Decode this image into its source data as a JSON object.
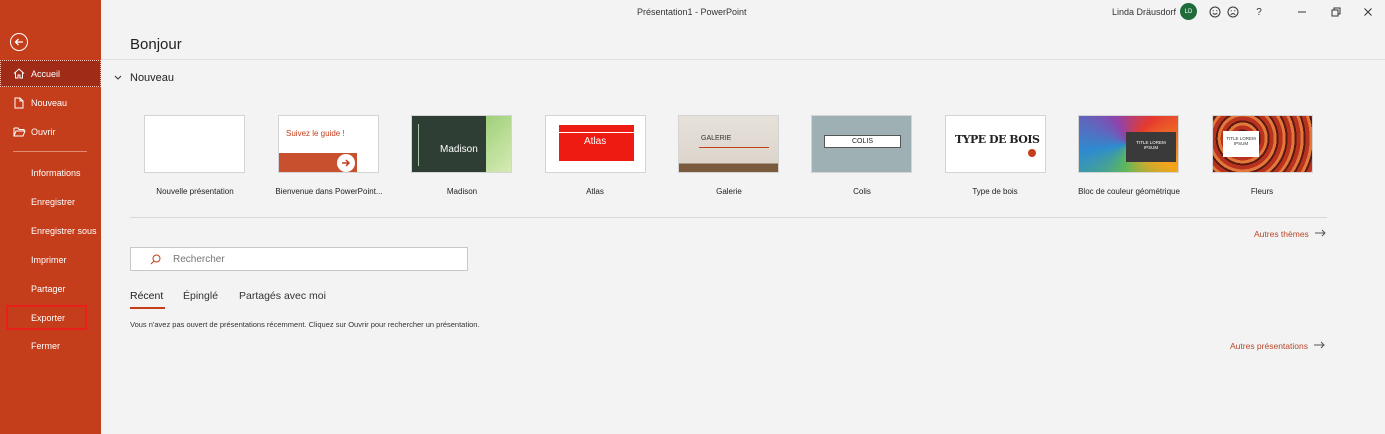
{
  "window": {
    "title": "Présentation1  -  PowerPoint"
  },
  "user": {
    "name": "Linda Dräusdorf",
    "initials": "LD"
  },
  "header": {
    "title": "Bonjour"
  },
  "sidebar": {
    "back_icon": "back-arrow-icon",
    "items": [
      {
        "label": "Accueil",
        "icon": "home-icon",
        "active": true
      },
      {
        "label": "Nouveau",
        "icon": "new-document-icon"
      },
      {
        "label": "Ouvrir",
        "icon": "folder-open-icon"
      },
      {
        "label": "Informations"
      },
      {
        "label": "Enregistrer"
      },
      {
        "label": "Enregistrer sous"
      },
      {
        "label": "Imprimer"
      },
      {
        "label": "Partager"
      },
      {
        "label": "Exporter",
        "highlighted": true
      },
      {
        "label": "Fermer"
      }
    ]
  },
  "new_section": {
    "title": "Nouveau",
    "templates": [
      {
        "label": "Nouvelle présentation"
      },
      {
        "label": "Bienvenue dans PowerPoint...",
        "thumb_text": "Suivez le guide !"
      },
      {
        "label": "Madison",
        "thumb_text": "Madison"
      },
      {
        "label": "Atlas",
        "thumb_text": "Atlas"
      },
      {
        "label": "Galerie",
        "thumb_text": "GALERIE"
      },
      {
        "label": "Colis",
        "thumb_text": "COLIS"
      },
      {
        "label": "Type de bois",
        "thumb_text": "TYPE DE BOIS"
      },
      {
        "label": "Bloc de couleur géométrique",
        "thumb_text": "TITLE LOREM IPSUM"
      },
      {
        "label": "Fleurs",
        "thumb_text": "TITLE LOREM IPSUM"
      }
    ],
    "more_themes": "Autres thèmes"
  },
  "search": {
    "placeholder": "Rechercher"
  },
  "tabs": [
    {
      "label": "Récent",
      "active": true
    },
    {
      "label": "Épinglé"
    },
    {
      "label": "Partagés avec moi"
    }
  ],
  "recent": {
    "empty_message": "Vous n'avez pas ouvert de présentations récemment. Cliquez sur Ouvrir pour rechercher un présentation.",
    "more_presentations": "Autres présentations"
  },
  "colors": {
    "accent": "#c43e1c",
    "sidebar_active": "#a02b16",
    "link": "#b7472a",
    "highlight_box": "#e8201b"
  }
}
